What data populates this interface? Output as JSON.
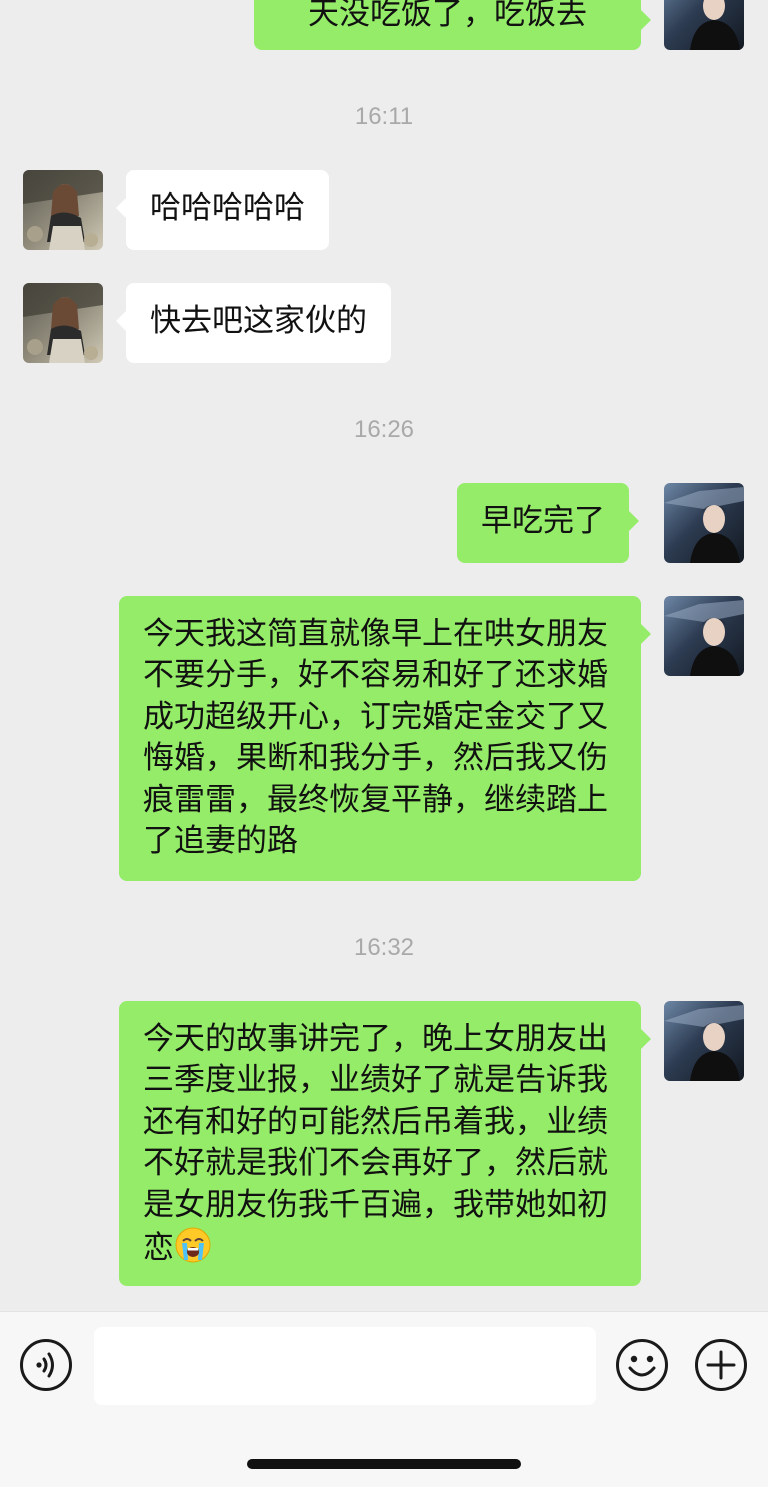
{
  "chat": {
    "top_partial_message": "天没吃饭了，吃饭去",
    "timestamps": [
      "16:11",
      "16:26",
      "16:32"
    ],
    "messages": [
      {
        "sender": "contact",
        "text": "哈哈哈哈哈"
      },
      {
        "sender": "contact",
        "text": "快去吧这家伙的"
      },
      {
        "sender": "me",
        "text": "早吃完了"
      },
      {
        "sender": "me",
        "text": "今天我这简直就像早上在哄女朋友不要分手，好不容易和好了还求婚成功超级开心，订完婚定金交了又悔婚，果断和我分手，然后我又伤痕雷雷，最终恢复平静，继续踏上了追妻的路"
      },
      {
        "sender": "me",
        "text": "今天的故事讲完了，晚上女朋友出三季度业报，业绩好了就是告诉我还有和好的可能然后吊着我，业绩不好就是我们不会再好了，然后就是女朋友伤我千百遍，我带她如初恋",
        "emoji": "loudly-crying-face"
      }
    ]
  },
  "input_bar": {
    "voice_icon": "voice-icon",
    "emoji_icon": "smiley-icon",
    "plus_icon": "plus-icon",
    "text_value": ""
  },
  "colors": {
    "background": "#ededed",
    "my_bubble": "#95ec69",
    "contact_bubble": "#ffffff",
    "timestamp": "#a9a9a9"
  }
}
